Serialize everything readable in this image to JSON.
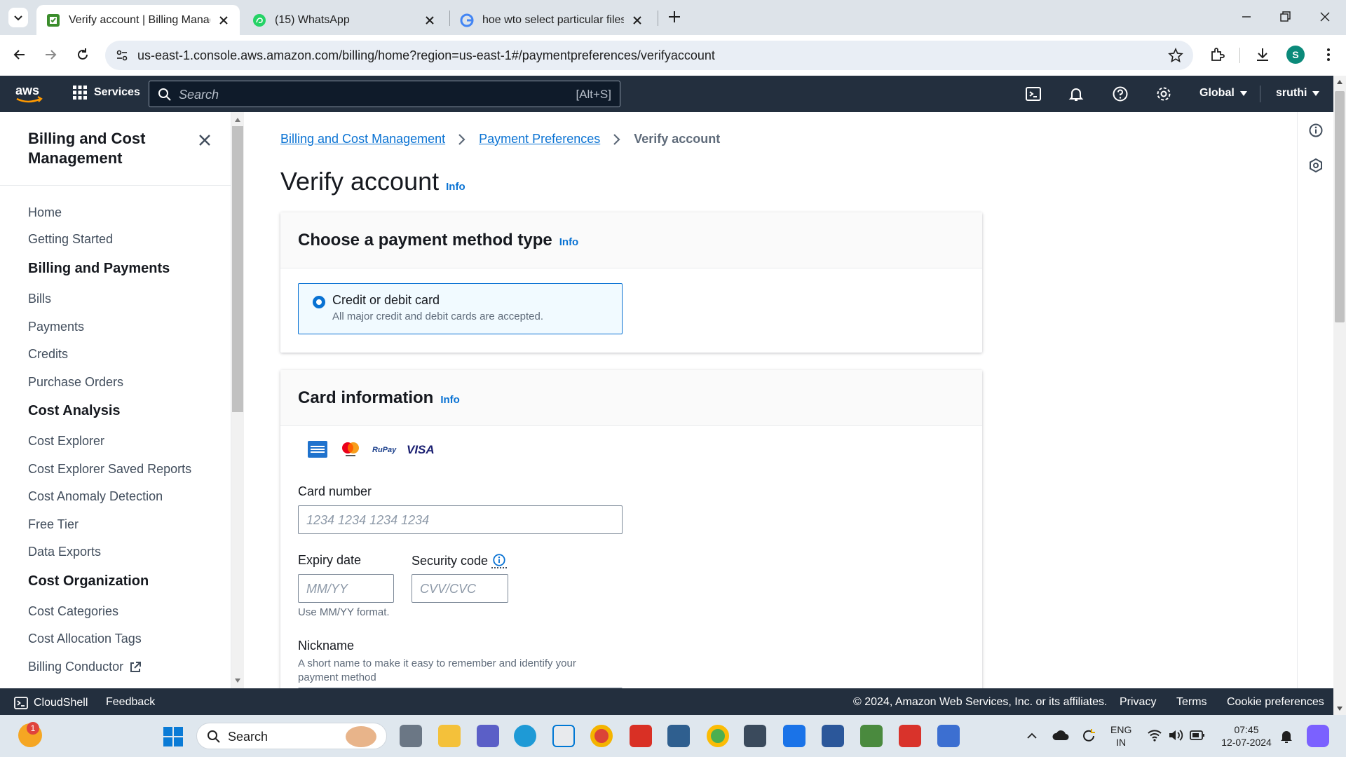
{
  "browser": {
    "tabs": [
      {
        "title": "Verify account | Billing Manager",
        "active": true
      },
      {
        "title": "(15) WhatsApp",
        "active": false
      },
      {
        "title": "hoe wto select particular files to",
        "active": false
      }
    ],
    "url": "us-east-1.console.aws.amazon.com/billing/home?region=us-east-1#/paymentpreferences/verifyaccount",
    "profile_initial": "S"
  },
  "aws_header": {
    "services_label": "Services",
    "search_placeholder": "Search",
    "search_shortcut": "[Alt+S]",
    "region_label": "Global",
    "user_label": "sruthi"
  },
  "sidebar": {
    "title": "Billing and Cost Management",
    "items": {
      "home": "Home",
      "getting_started": "Getting Started",
      "billing_payments": "Billing and Payments",
      "bills": "Bills",
      "payments": "Payments",
      "credits": "Credits",
      "purchase_orders": "Purchase Orders",
      "cost_analysis": "Cost Analysis",
      "cost_explorer": "Cost Explorer",
      "cost_explorer_saved": "Cost Explorer Saved Reports",
      "cost_anomaly": "Cost Anomaly Detection",
      "free_tier": "Free Tier",
      "data_exports": "Data Exports",
      "cost_organization": "Cost Organization",
      "cost_categories": "Cost Categories",
      "cost_allocation_tags": "Cost Allocation Tags",
      "billing_conductor": "Billing Conductor"
    }
  },
  "breadcrumb": {
    "level1": "Billing and Cost Management",
    "level2": "Payment Preferences",
    "current": "Verify account"
  },
  "page": {
    "title": "Verify account",
    "info": "Info"
  },
  "payment_type": {
    "heading": "Choose a payment method type",
    "info": "Info",
    "option_label": "Credit or debit card",
    "option_desc": "All major credit and debit cards are accepted."
  },
  "card_info": {
    "heading": "Card information",
    "info": "Info",
    "card_number_label": "Card number",
    "card_number_placeholder": "1234 1234 1234 1234",
    "expiry_label": "Expiry date",
    "expiry_placeholder": "MM/YY",
    "expiry_hint": "Use MM/YY format.",
    "security_label": "Security code",
    "security_placeholder": "CVV/CVC",
    "nickname_label": "Nickname",
    "nickname_hint": "A short name to make it easy to remember and identify your payment method",
    "brands": [
      "amex-icon",
      "mastercard-icon",
      "rupay-icon",
      "visa-icon"
    ],
    "brand_text": {
      "rupay": "RuPay",
      "visa": "VISA"
    }
  },
  "footer": {
    "cloudshell": "CloudShell",
    "feedback": "Feedback",
    "copyright": "© 2024, Amazon Web Services, Inc. or its affiliates.",
    "privacy": "Privacy",
    "terms": "Terms",
    "cookie": "Cookie preferences"
  },
  "taskbar": {
    "search_label": "Search",
    "lang_line1": "ENG",
    "lang_line2": "IN",
    "time": "07:45",
    "date": "12-07-2024",
    "notif_count": "1"
  },
  "colors": {
    "aws_header_bg": "#232f3e",
    "link": "#0972d3",
    "tabbar_bg": "#dde3e9"
  }
}
